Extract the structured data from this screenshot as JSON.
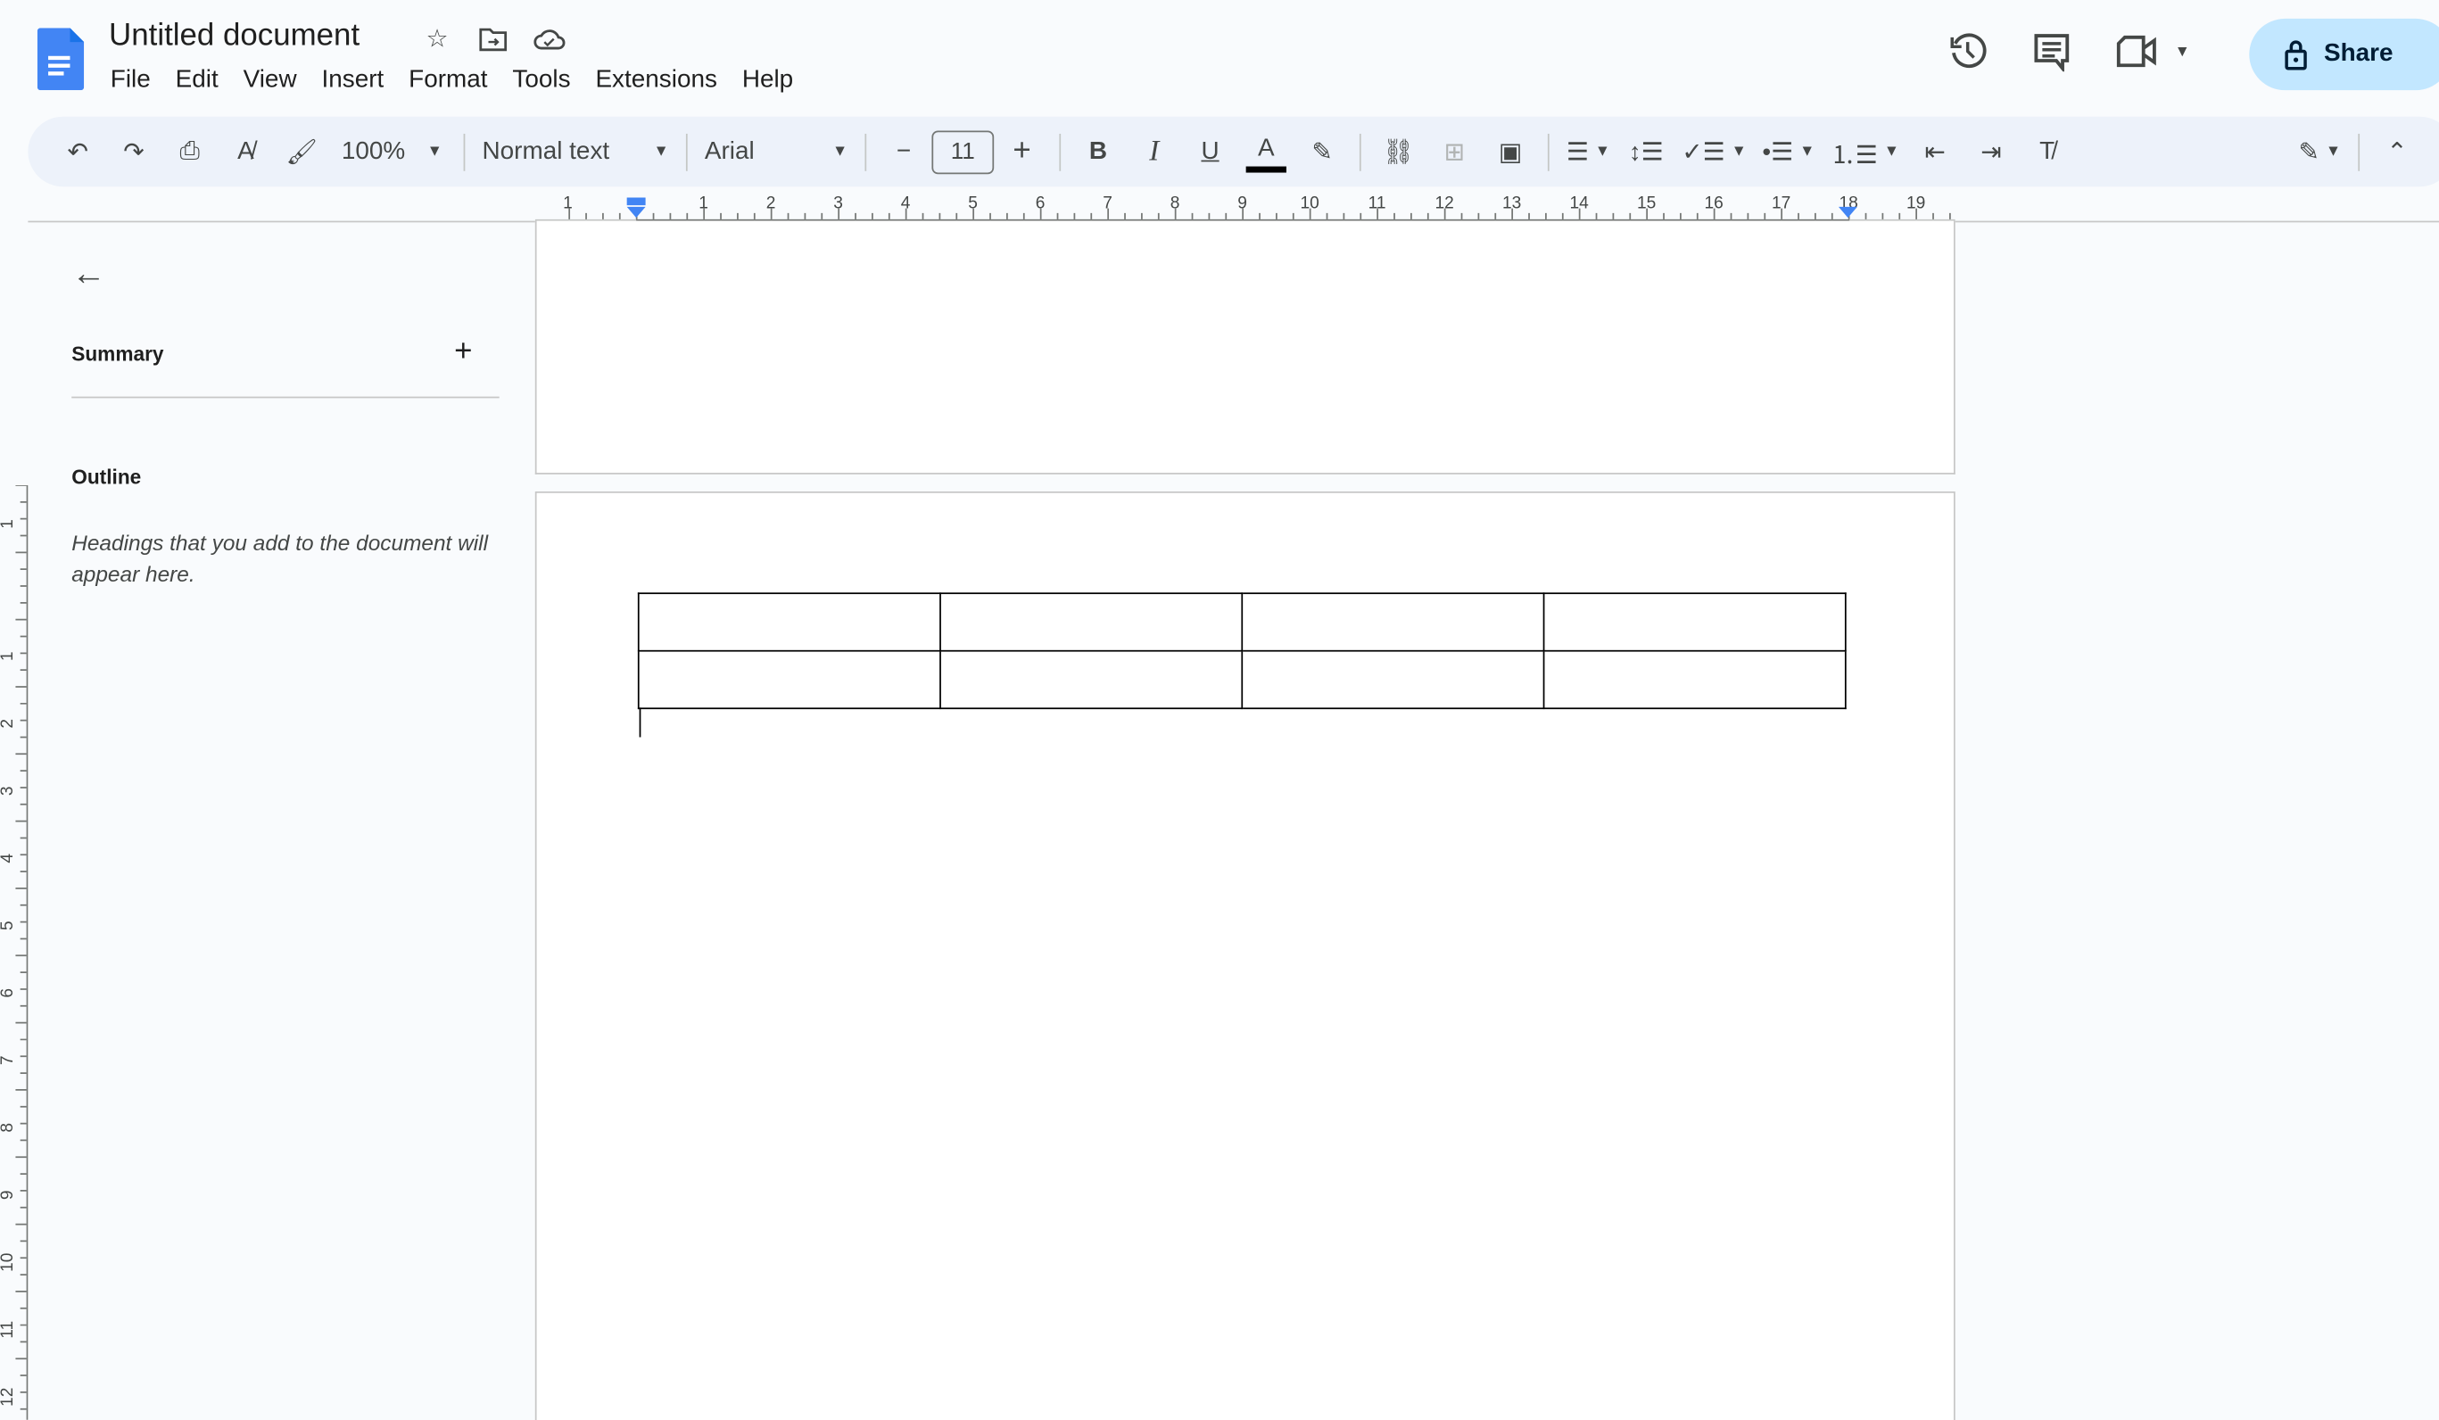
{
  "app": {
    "title": "Untitled document",
    "brand_color": "#4285f4"
  },
  "menu": [
    "File",
    "Edit",
    "View",
    "Insert",
    "Format",
    "Tools",
    "Extensions",
    "Help"
  ],
  "header_icons": [
    "star-icon",
    "move-folder-icon",
    "cloud-saved-icon",
    "history-icon",
    "comments-icon",
    "meet-icon"
  ],
  "share": {
    "label": "Share",
    "color": "#c2e7ff"
  },
  "toolbar": {
    "zoom": "100%",
    "style": "Normal text",
    "font": "Arial",
    "font_size": "11",
    "bold": "B",
    "italic": "I",
    "underline": "U",
    "text_color": "A"
  },
  "ruler": {
    "h_labels": [
      "1",
      "1",
      "2",
      "3",
      "4",
      "5",
      "6",
      "7",
      "8",
      "9",
      "10",
      "11",
      "12",
      "13",
      "14",
      "15",
      "16",
      "17",
      "18",
      "19"
    ],
    "v_labels": [
      "1",
      "1",
      "2",
      "3",
      "4",
      "5",
      "6",
      "7",
      "8",
      "9",
      "10",
      "11",
      "12"
    ]
  },
  "sidebar": {
    "summary": "Summary",
    "outline": "Outline",
    "hint": "Headings that you add to the document will appear here."
  },
  "document": {
    "table": {
      "rows": 2,
      "cols": 4,
      "cells": [
        [
          "",
          "",
          "",
          ""
        ],
        [
          "",
          "",
          "",
          ""
        ]
      ]
    }
  }
}
